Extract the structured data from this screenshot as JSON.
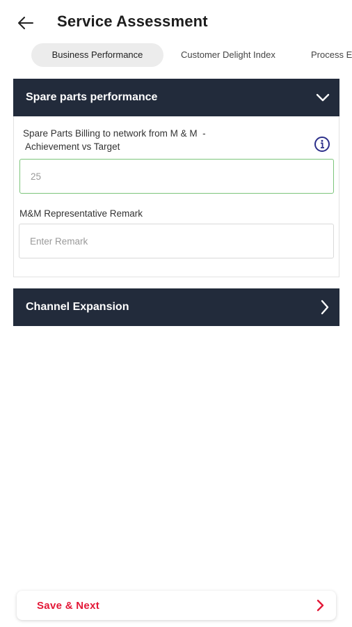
{
  "header": {
    "title": "Service Assessment",
    "back_icon": "arrow-left-icon"
  },
  "tabs": [
    {
      "label": "Business Performance",
      "active": true
    },
    {
      "label": "Customer Delight Index",
      "active": false
    },
    {
      "label": "Process Ex",
      "active": false
    }
  ],
  "sections": {
    "spare_parts": {
      "title": "Spare parts performance",
      "expanded": true,
      "toggle_icon": "chevron-down-icon",
      "fields": {
        "billing": {
          "label_line1": "Spare Parts Billing to network from M & M  -",
          "label_line2": " Achievement vs Target",
          "value": "25",
          "info_icon": "info-icon"
        },
        "remark": {
          "label": "M&M Representative Remark",
          "placeholder": "Enter Remark",
          "value": ""
        }
      }
    },
    "channel_expansion": {
      "title": "Channel Expansion",
      "expanded": false,
      "toggle_icon": "chevron-right-icon"
    }
  },
  "footer": {
    "save_label": "Save & Next",
    "arrow_icon": "chevron-right-icon"
  },
  "colors": {
    "header_bg": "#222b3b",
    "accent_red": "#e31837",
    "active_input_border": "#7cc47a",
    "tab_active_bg": "#ececec",
    "info_icon": "#2c2f8a"
  }
}
